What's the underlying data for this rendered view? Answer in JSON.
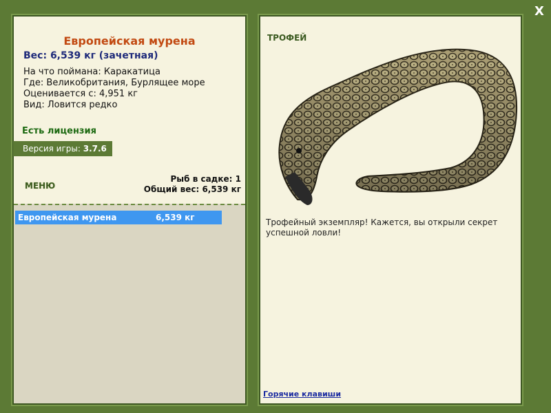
{
  "window": {
    "close_label": "X"
  },
  "fish": {
    "name": "Европейская мурена",
    "weight_line": "Вес: 6,539 кг (зачетная)",
    "caught_on": "На что поймана: Каракатица",
    "location": "Где: Великобритания, Бурлящее море",
    "valued_from": "Оценивается с: 4,951 кг",
    "rarity": "Вид: Ловится редко"
  },
  "license": "Есть лицензия",
  "version": {
    "label": "Версия игры:",
    "value": "3.7.6"
  },
  "menu_label": "МЕНЮ",
  "keepnet": {
    "count": "Рыб в садке: 1",
    "total": "Общий вес: 6,539 кг",
    "items": [
      {
        "name": "Европейская мурена",
        "weight": "6,539 кг"
      }
    ]
  },
  "trophy": {
    "label": "ТРОФЕЙ",
    "text": "Трофейный экземпляр! Кажется, вы открыли секрет успешной ловли!"
  },
  "hotkeys_label": "Горячие клавиши",
  "colors": {
    "frame": "#5c7a35",
    "panel": "#f6f3df",
    "title": "#c24a12",
    "selection": "#3f97f0"
  }
}
